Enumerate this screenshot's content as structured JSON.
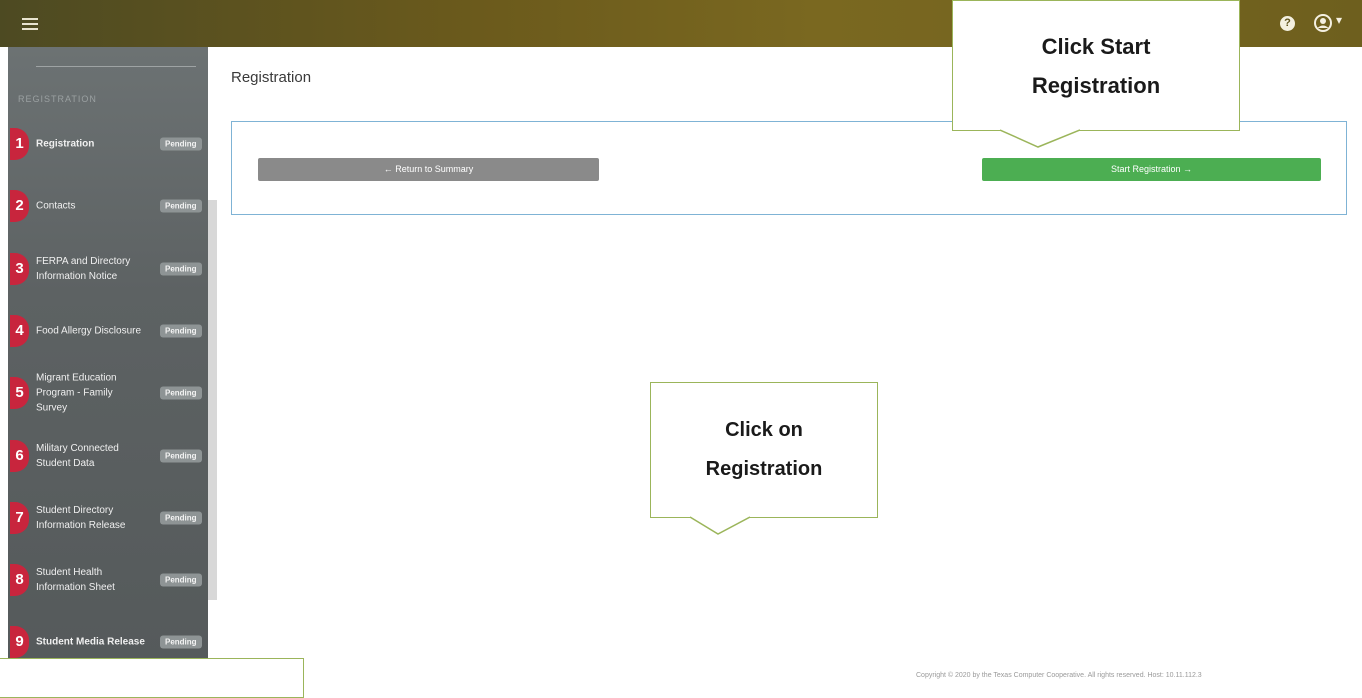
{
  "sidebar": {
    "section_label": "REGISTRATION",
    "items": [
      {
        "number": "1",
        "label": "Registration",
        "badge": "Pending"
      },
      {
        "number": "2",
        "label": "Contacts",
        "badge": "Pending"
      },
      {
        "number": "3",
        "label": "FERPA and Directory Information Notice",
        "badge": "Pending"
      },
      {
        "number": "4",
        "label": "Food Allergy Disclosure",
        "badge": "Pending"
      },
      {
        "number": "5",
        "label": "Migrant Education Program - Family Survey",
        "badge": "Pending"
      },
      {
        "number": "6",
        "label": "Military Connected Student Data",
        "badge": "Pending"
      },
      {
        "number": "7",
        "label": "Student Directory Information Release",
        "badge": "Pending"
      },
      {
        "number": "8",
        "label": "Student Health Information Sheet",
        "badge": "Pending"
      },
      {
        "number": "9",
        "label": "Student Media Release",
        "badge": "Pending"
      }
    ]
  },
  "main": {
    "title": "Registration",
    "return_label": "← Return to Summary",
    "start_label": "Start Registration →"
  },
  "callouts": {
    "start": "Click Start\nRegistration",
    "registration": "Click on\nRegistration"
  },
  "header": {
    "help_icon": "question-icon",
    "user_icon": "user-icon",
    "menu_icon": "menu-icon"
  },
  "colors": {
    "topbar": "#6b5a1c",
    "badge_red": "#c8253d",
    "start_green": "#4cae52",
    "return_gray": "#8a8a8a",
    "box_border": "#7fb3d5",
    "callout_border": "#9bb55a"
  },
  "footer": {
    "text": "Copyright © 2020 by the Texas Computer Cooperative. All rights reserved. Host: 10.11.112.3"
  }
}
